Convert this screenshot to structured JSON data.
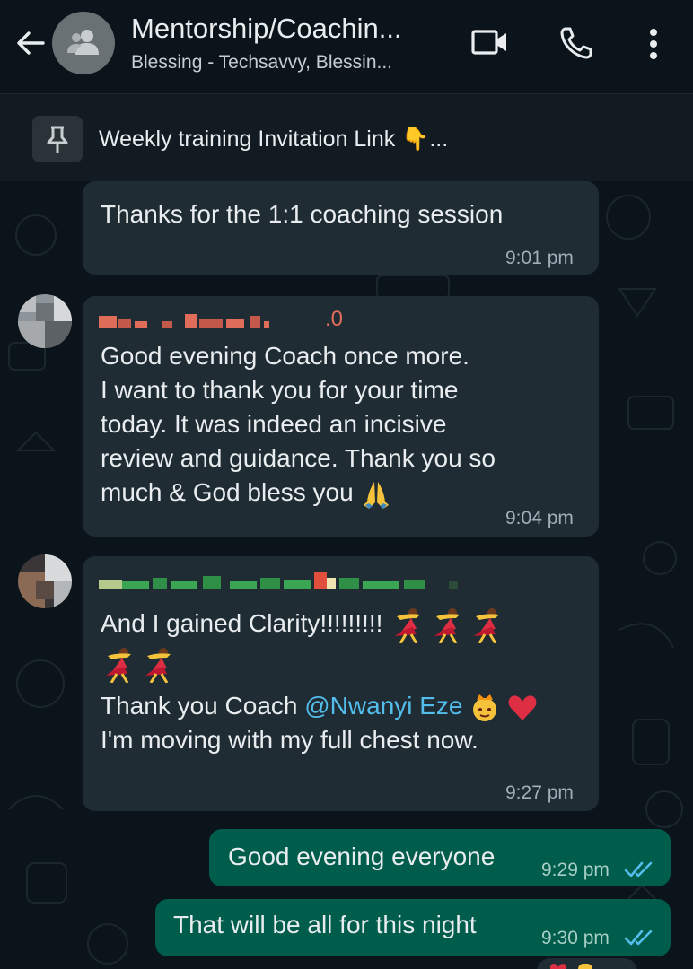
{
  "header": {
    "title": "Mentorship/Coachin...",
    "subtitle": "Blessing - Techsavvy, Blessin..."
  },
  "pinned": {
    "text": "Weekly training Invitation Link 👇..."
  },
  "messages": [
    {
      "text": "Thanks for the 1:1 coaching session",
      "time": "9:01 pm"
    },
    {
      "sender_suffix": ".0",
      "lines": [
        "Good evening Coach once more.",
        "I want to thank you for your time",
        "today. It was indeed an incisive",
        "review and guidance. Thank you so",
        "much & God bless you"
      ],
      "time": "9:04 pm"
    },
    {
      "line1": "And I gained Clarity!!!!!!!!!",
      "line3_prefix": "Thank you Coach ",
      "mention": "@Nwanyi Eze",
      "line4": "I'm moving with my full chest now.",
      "time": "9:27 pm"
    },
    {
      "text": "Good evening everyone",
      "time": "9:29 pm"
    },
    {
      "text": "That will be all for this night",
      "time": "9:30 pm"
    }
  ],
  "colors": {
    "background": "#0b141a",
    "incoming_bubble": "#1f2c34",
    "outgoing_bubble": "#005c4b",
    "mention": "#53bdeb",
    "read_ticks": "#53bdeb"
  },
  "icons": [
    "back-arrow-icon",
    "group-avatar-icon",
    "video-call-icon",
    "phone-icon",
    "more-options-icon",
    "pin-icon",
    "read-receipt-icon",
    "folded-hands-emoji",
    "dancer-emoji",
    "princess-emoji",
    "heart-emoji"
  ]
}
